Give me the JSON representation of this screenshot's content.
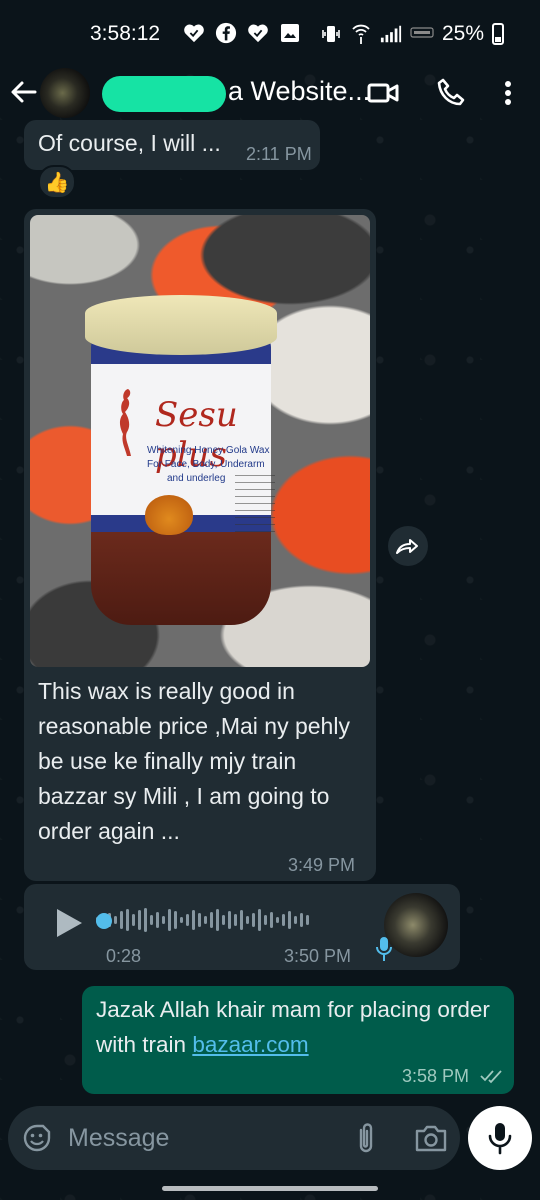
{
  "status_bar": {
    "time": "3:58:12",
    "battery": "25%",
    "icons": [
      "heart-icon",
      "facebook-icon",
      "heart-icon",
      "image-icon",
      "vibrate-icon",
      "wifi-icon",
      "signal-icon",
      "volte-icon",
      "battery-icon"
    ]
  },
  "header": {
    "contact_name_suffix": "a Website...",
    "icons": [
      "back-arrow-icon",
      "video-call-icon",
      "phone-icon",
      "more-vert-icon"
    ]
  },
  "messages": [
    {
      "direction": "incoming",
      "text": "Of course, I will ...",
      "time": "2:11 PM",
      "reaction": "👍"
    },
    {
      "direction": "incoming",
      "type": "image",
      "image_label": {
        "brand": "Sesu plus",
        "lines": [
          "Whitening Honey Gola Wax",
          "For Face, Body, Underarm",
          "and underleg"
        ]
      },
      "text": "This wax is really good in reasonable price ,Mai ny pehly be use ke finally mjy train bazzar sy Mili , I am going to order again ...",
      "time": "3:49 PM"
    },
    {
      "direction": "incoming",
      "type": "voice",
      "duration": "0:28",
      "time": "3:50 PM"
    },
    {
      "direction": "outgoing",
      "text": "Jazak Allah khair mam for placing order with train",
      "link": "bazaar.com",
      "time": "3:58 PM",
      "status": "read"
    }
  ],
  "composer": {
    "placeholder": "Message",
    "icons": [
      "emoji-icon",
      "attach-icon",
      "camera-icon",
      "mic-icon"
    ]
  },
  "colors": {
    "background": "#0b141a",
    "incoming_bubble": "#202c33",
    "outgoing_bubble": "#005c4b",
    "accent_blue": "#53bdeb",
    "redaction": "#16e3a4"
  }
}
